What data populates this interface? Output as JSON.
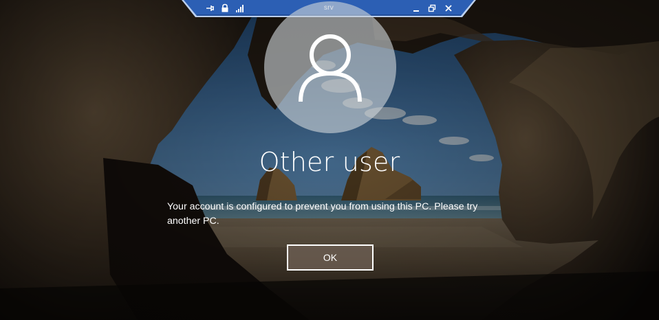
{
  "rdp_bar": {
    "title": "srv",
    "icons": {
      "pin": "pin-icon",
      "lock": "lock-icon",
      "signal": "connection-signal-icon",
      "minimize": "minimize-icon",
      "restore": "restore-icon",
      "close": "close-icon"
    },
    "colors": {
      "bar": "#2c5fb4",
      "bar_border": "#bcd0ee"
    }
  },
  "lock_screen": {
    "avatar_icon": "user-icon",
    "username": "Other user",
    "message": "Your account is configured to prevent you from using this PC. Please try another PC.",
    "ok_label": "OK"
  }
}
